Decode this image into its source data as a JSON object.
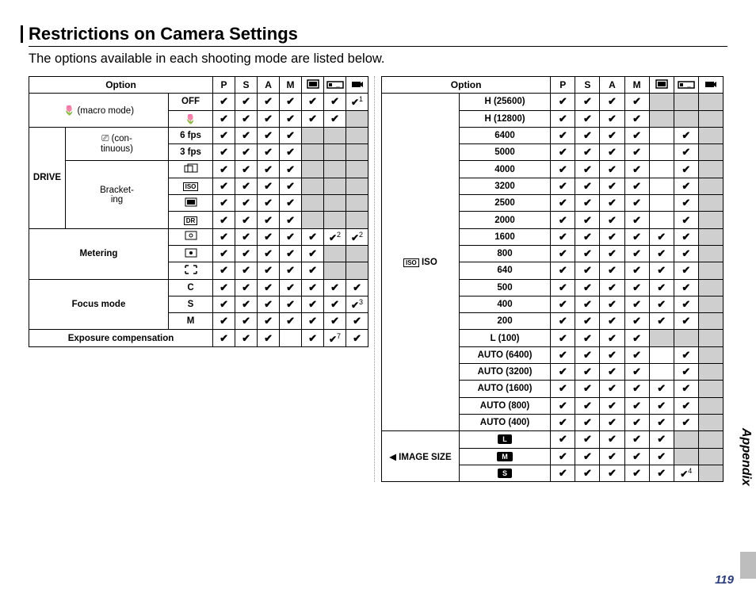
{
  "pageNumber": "119",
  "sideTab": "Appendix",
  "heading": "Restrictions on Camera Settings",
  "intro": "The options available in each shooting mode are listed below.",
  "modeHeaders": [
    "P",
    "S",
    "A",
    "M",
    "□",
    "▭",
    "🎥"
  ],
  "left": {
    "optionHeader": "Option",
    "groups": [
      {
        "groupLabel": "🌷 (macro mode)",
        "colspan": 3,
        "rows": [
          {
            "label": "OFF",
            "cells": [
              "c",
              "c",
              "c",
              "c",
              "c",
              "c",
              "c1"
            ]
          },
          {
            "label": "🌷",
            "cells": [
              "c",
              "c",
              "c",
              "c",
              "c",
              "c",
              "s"
            ]
          }
        ]
      },
      {
        "groupLabel": "DRIVE",
        "colspan": 1,
        "sub": [
          {
            "subLabel": "📷 (continuous)",
            "rows": [
              {
                "label": "6 fps",
                "cells": [
                  "c",
                  "c",
                  "c",
                  "c",
                  "s",
                  "s",
                  "s"
                ]
              },
              {
                "label": "3 fps",
                "cells": [
                  "c",
                  "c",
                  "c",
                  "c",
                  "s",
                  "s",
                  "s"
                ]
              }
            ]
          },
          {
            "subLabel": "Bracketing",
            "rows": [
              {
                "label": "AE",
                "icon": "ae",
                "cells": [
                  "c",
                  "c",
                  "c",
                  "c",
                  "s",
                  "s",
                  "s"
                ]
              },
              {
                "label": "ISO",
                "icon": "iso",
                "cells": [
                  "c",
                  "c",
                  "c",
                  "c",
                  "s",
                  "s",
                  "s"
                ]
              },
              {
                "label": "FILM",
                "icon": "film",
                "cells": [
                  "c",
                  "c",
                  "c",
                  "c",
                  "s",
                  "s",
                  "s"
                ]
              },
              {
                "label": "DR",
                "icon": "dr",
                "cells": [
                  "c",
                  "c",
                  "c",
                  "c",
                  "s",
                  "s",
                  "s"
                ]
              }
            ]
          }
        ]
      },
      {
        "groupLabel": "Metering",
        "colspan": 3,
        "rows": [
          {
            "label": "MULTI",
            "icon": "multi",
            "cells": [
              "c",
              "c",
              "c",
              "c",
              "c",
              "c2",
              "c2"
            ]
          },
          {
            "label": "SPOT",
            "icon": "spot",
            "cells": [
              "c",
              "c",
              "c",
              "c",
              "c",
              "s",
              "s"
            ]
          },
          {
            "label": "AVG",
            "icon": "avg",
            "cells": [
              "c",
              "c",
              "c",
              "c",
              "c",
              "s",
              "s"
            ]
          }
        ]
      },
      {
        "groupLabel": "Focus mode",
        "colspan": 3,
        "rows": [
          {
            "label": "C",
            "cells": [
              "c",
              "c",
              "c",
              "c",
              "c",
              "c",
              "c"
            ]
          },
          {
            "label": "S",
            "cells": [
              "c",
              "c",
              "c",
              "c",
              "c",
              "c",
              "c3"
            ]
          },
          {
            "label": "M",
            "cells": [
              "c",
              "c",
              "c",
              "c",
              "c",
              "c",
              "c"
            ]
          }
        ]
      },
      {
        "groupLabel": "Exposure compensation",
        "colspan": 4,
        "rows": [
          {
            "label": null,
            "cells": [
              "c",
              "c",
              "c",
              "",
              "c",
              "c7",
              "c"
            ]
          }
        ]
      }
    ]
  },
  "right": {
    "optionHeader": "Option",
    "groups": [
      {
        "groupLabel": "ISO",
        "icon": "iso",
        "rows": [
          {
            "label": "H (25600)",
            "cells": [
              "c",
              "c",
              "c",
              "c",
              "s",
              "s",
              "s"
            ]
          },
          {
            "label": "H (12800)",
            "cells": [
              "c",
              "c",
              "c",
              "c",
              "s",
              "s",
              "s"
            ]
          },
          {
            "label": "6400",
            "cells": [
              "c",
              "c",
              "c",
              "c",
              "",
              "c",
              "s"
            ]
          },
          {
            "label": "5000",
            "cells": [
              "c",
              "c",
              "c",
              "c",
              "",
              "c",
              "s"
            ]
          },
          {
            "label": "4000",
            "cells": [
              "c",
              "c",
              "c",
              "c",
              "",
              "c",
              "s"
            ]
          },
          {
            "label": "3200",
            "cells": [
              "c",
              "c",
              "c",
              "c",
              "",
              "c",
              "s"
            ]
          },
          {
            "label": "2500",
            "cells": [
              "c",
              "c",
              "c",
              "c",
              "",
              "c",
              "s"
            ]
          },
          {
            "label": "2000",
            "cells": [
              "c",
              "c",
              "c",
              "c",
              "",
              "c",
              "s"
            ]
          },
          {
            "label": "1600",
            "cells": [
              "c",
              "c",
              "c",
              "c",
              "c",
              "c",
              "s"
            ]
          },
          {
            "label": "800",
            "cells": [
              "c",
              "c",
              "c",
              "c",
              "c",
              "c",
              "s"
            ]
          },
          {
            "label": "640",
            "cells": [
              "c",
              "c",
              "c",
              "c",
              "c",
              "c",
              "s"
            ]
          },
          {
            "label": "500",
            "cells": [
              "c",
              "c",
              "c",
              "c",
              "c",
              "c",
              "s"
            ]
          },
          {
            "label": "400",
            "cells": [
              "c",
              "c",
              "c",
              "c",
              "c",
              "c",
              "s"
            ]
          },
          {
            "label": "200",
            "cells": [
              "c",
              "c",
              "c",
              "c",
              "c",
              "c",
              "s"
            ]
          },
          {
            "label": "L (100)",
            "cells": [
              "c",
              "c",
              "c",
              "c",
              "s",
              "s",
              "s"
            ]
          },
          {
            "label": "AUTO (6400)",
            "cells": [
              "c",
              "c",
              "c",
              "c",
              "",
              "c",
              "s"
            ]
          },
          {
            "label": "AUTO (3200)",
            "cells": [
              "c",
              "c",
              "c",
              "c",
              "",
              "c",
              "s"
            ]
          },
          {
            "label": "AUTO (1600)",
            "cells": [
              "c",
              "c",
              "c",
              "c",
              "c",
              "c",
              "s"
            ]
          },
          {
            "label": "AUTO (800)",
            "cells": [
              "c",
              "c",
              "c",
              "c",
              "c",
              "c",
              "s"
            ]
          },
          {
            "label": "AUTO (400)",
            "cells": [
              "c",
              "c",
              "c",
              "c",
              "c",
              "c",
              "s"
            ]
          }
        ]
      },
      {
        "groupLabel": "IMAGE SIZE",
        "icon": "size",
        "rows": [
          {
            "label": "L",
            "icon": "szL",
            "cells": [
              "c",
              "c",
              "c",
              "c",
              "c",
              "s",
              "s"
            ]
          },
          {
            "label": "M",
            "icon": "szM",
            "cells": [
              "c",
              "c",
              "c",
              "c",
              "c",
              "s",
              "s"
            ]
          },
          {
            "label": "S",
            "icon": "szS",
            "cells": [
              "c",
              "c",
              "c",
              "c",
              "c",
              "c4",
              "s"
            ]
          }
        ]
      }
    ]
  },
  "icons": {
    "flower": "🌷",
    "burst": "📷",
    "iso": "ISO",
    "film": "▦",
    "dr": "DR",
    "ae": "▢",
    "multi": "⊡",
    "spot": "⊙",
    "avg": "[ ]",
    "szL": "L",
    "szM": "M",
    "szS": "S",
    "size": "◀"
  }
}
